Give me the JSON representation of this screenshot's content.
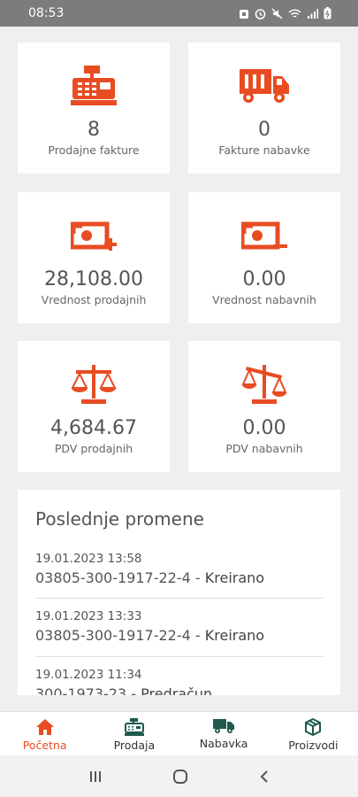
{
  "status_bar": {
    "time": "08:53"
  },
  "colors": {
    "accent": "#e84c22",
    "nav_dark": "#1f5a4c"
  },
  "cards": [
    {
      "value": "8",
      "label": "Prodajne fakture",
      "icon": "cash-register-icon"
    },
    {
      "value": "0",
      "label": "Fakture nabavke",
      "icon": "truck-icon"
    },
    {
      "value": "28,108.00",
      "label": "Vrednost prodajnih",
      "icon": "money-plus-icon"
    },
    {
      "value": "0.00",
      "label": "Vrednost nabavnih",
      "icon": "money-minus-icon"
    },
    {
      "value": "4,684.67",
      "label": "PDV prodajnih",
      "icon": "balance-scale-icon"
    },
    {
      "value": "0.00",
      "label": "PDV nabavnih",
      "icon": "balance-scale-tilted-icon"
    }
  ],
  "recent": {
    "title": "Poslednje promene",
    "entries": [
      {
        "timestamp": "19.01.2023 13:58",
        "doc": "03805-300-1917-22-4",
        "sep": " - ",
        "status": "Kreirano"
      },
      {
        "timestamp": "19.01.2023 13:33",
        "doc": "03805-300-1917-22-4",
        "sep": " - ",
        "status": "Kreirano"
      },
      {
        "timestamp": "19.01.2023 11:34",
        "doc": "300-1973-23",
        "sep": " - ",
        "status": "Predračun"
      }
    ]
  },
  "bottom_nav": [
    {
      "label": "Početna",
      "icon": "home-icon",
      "active": true
    },
    {
      "label": "Prodaja",
      "icon": "cash-register-icon",
      "active": false
    },
    {
      "label": "Nabavka",
      "icon": "truck-icon",
      "active": false
    },
    {
      "label": "Proizvodi",
      "icon": "box-icon",
      "active": false
    }
  ]
}
